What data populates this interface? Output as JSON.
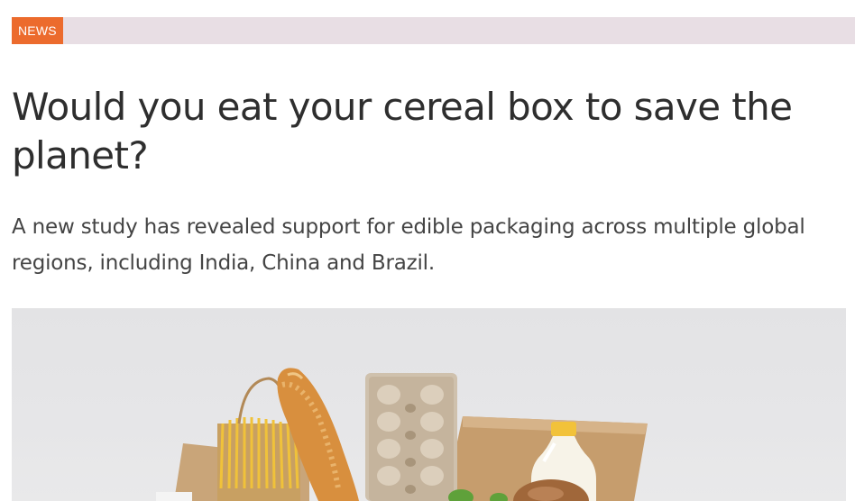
{
  "category": {
    "label": "NEWS",
    "color": "#ec6b2d",
    "bar_color": "#e8dee4"
  },
  "article": {
    "headline": "Would you eat your cereal box to save the planet?",
    "standfirst": "A new study has revealed support for edible packaging across multiple global regions, including India, China and Brazil."
  },
  "hero_image": {
    "subject": "cardboard box with baguette, spaghetti, egg carton, milk bottle and bread"
  }
}
